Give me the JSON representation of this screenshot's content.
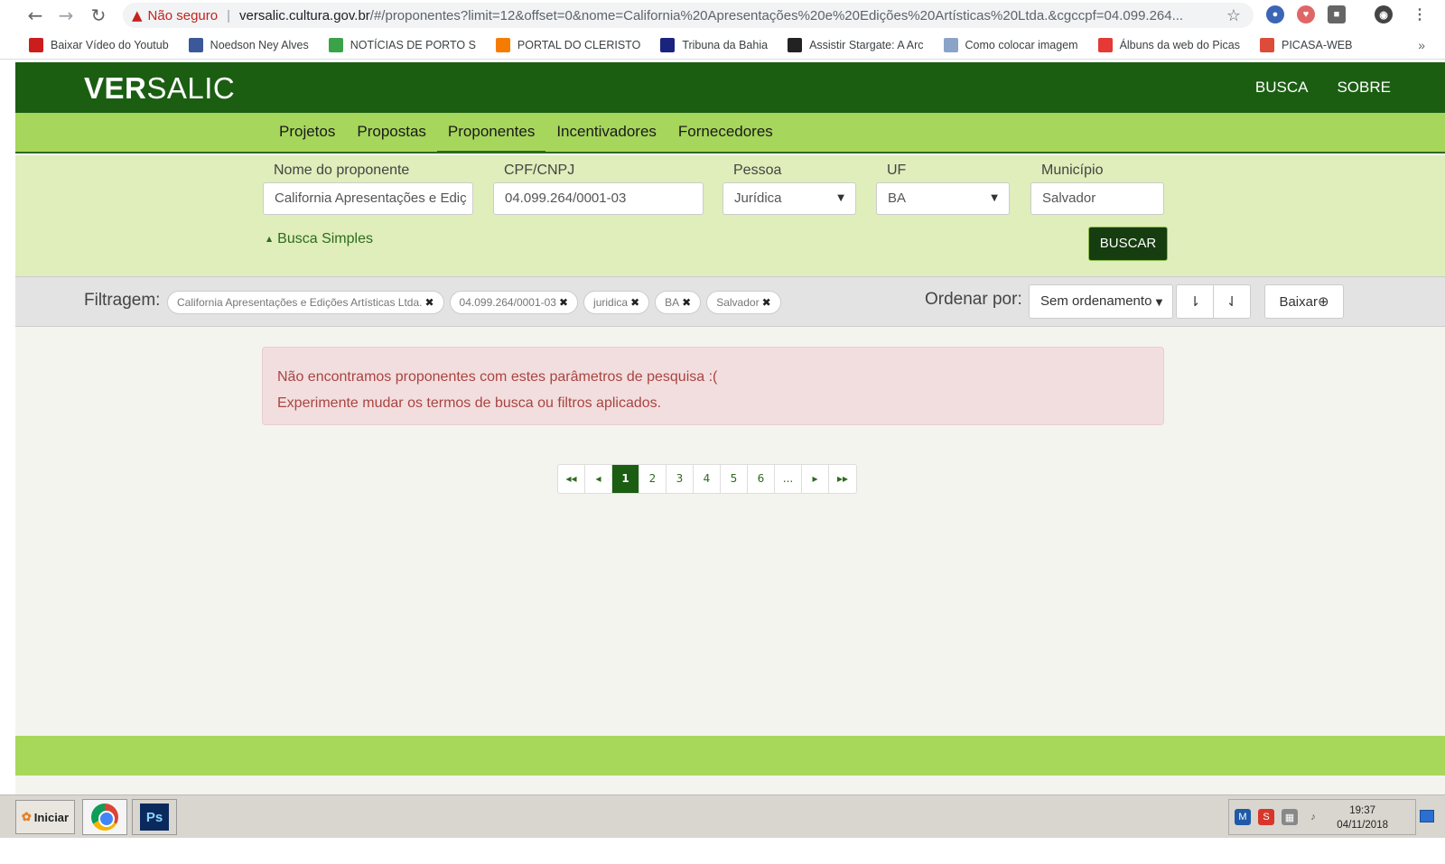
{
  "browser": {
    "security_label": "Não seguro",
    "url_host": "versalic.cultura.gov.br",
    "url_path": "/#/proponentes?limit=12&offset=0&nome=California%20Apresentações%20e%20Edições%20Artísticas%20Ltda.&cgccpf=04.099.264...",
    "bookmarks": [
      {
        "label": "Baixar Vídeo do Youtub",
        "icon": "youtube-icon",
        "color": "#cc1d1d"
      },
      {
        "label": "Noedson Ney Alves",
        "icon": "facebook-icon",
        "color": "#3b5998"
      },
      {
        "label": "NOTÍCIAS DE PORTO S",
        "icon": "globe-icon",
        "color": "#3aa34a"
      },
      {
        "label": "PORTAL DO CLERISTO",
        "icon": "blogger-icon",
        "color": "#f57c00"
      },
      {
        "label": "Tribuna da Bahia",
        "icon": "t-icon",
        "color": "#1a237e"
      },
      {
        "label": "Assistir Stargate: A Arc",
        "icon": "play-icon",
        "color": "#222222"
      },
      {
        "label": "Como colocar imagem",
        "icon": "image-icon",
        "color": "#8aa4c8"
      },
      {
        "label": "Álbuns da web do Picas",
        "icon": "picasa-icon",
        "color": "#e53935"
      },
      {
        "label": "PICASA-WEB",
        "icon": "google-plus-icon",
        "color": "#dd4b39"
      }
    ],
    "more_label": "»"
  },
  "site": {
    "logo_bold": "VER",
    "logo_light": "SALIC",
    "top_links": [
      "BUSCA",
      "SOBRE"
    ],
    "tabs": [
      "Projetos",
      "Propostas",
      "Proponentes",
      "Incentivadores",
      "Fornecedores"
    ],
    "active_tab": "Proponentes"
  },
  "filters": {
    "nome_label": "Nome do proponente",
    "nome_value": "California Apresentações e Ediç",
    "cpf_label": "CPF/CNPJ",
    "cpf_value": "04.099.264/0001-03",
    "pessoa_label": "Pessoa",
    "pessoa_value": "Jurídica",
    "uf_label": "UF",
    "uf_value": "BA",
    "municipio_label": "Município",
    "municipio_value": "Salvador",
    "busca_simples": "Busca Simples",
    "buscar_button": "BUSCAR"
  },
  "filterbar": {
    "label": "Filtragem:",
    "chips": [
      "California Apresentações e Edições Artísticas Ltda.",
      "04.099.264/0001-03",
      "juridica",
      "BA",
      "Salvador"
    ],
    "ordenar_label": "Ordenar por:",
    "sort_value": "Sem ordenamento",
    "baixar_label": "Baixar"
  },
  "alert": {
    "line1": "Não encontramos proponentes com estes parâmetros de pesquisa :(",
    "line2": "Experimente mudar os termos de busca ou filtros aplicados."
  },
  "pagination": {
    "first": "◂◂",
    "prev": "◂",
    "pages": [
      "1",
      "2",
      "3",
      "4",
      "5",
      "6"
    ],
    "ellipsis": "...",
    "next": "▸",
    "last": "▸▸",
    "active_page": "1"
  },
  "taskbar": {
    "start_label": "Iniciar",
    "ps_label": "Ps",
    "time": "19:37",
    "date": "04/11/2018"
  }
}
